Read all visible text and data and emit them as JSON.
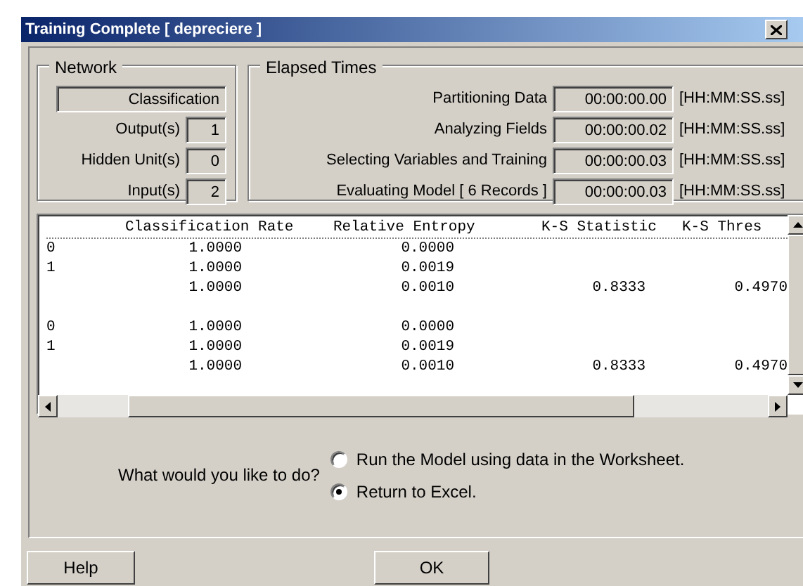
{
  "window": {
    "title": "Training Complete [ depreciere ]"
  },
  "network": {
    "group_label": "Network",
    "type_value": "Classification",
    "fields": [
      {
        "label": "Output(s)",
        "value": "1"
      },
      {
        "label": "Hidden Unit(s)",
        "value": "0"
      },
      {
        "label": "Input(s)",
        "value": "2"
      }
    ]
  },
  "elapsed": {
    "group_label": "Elapsed Times",
    "rows": [
      {
        "label": "Partitioning Data",
        "value": "00:00:00.00",
        "unit": "[HH:MM:SS.ss]"
      },
      {
        "label": "Analyzing Fields",
        "value": "00:00:00.02",
        "unit": "[HH:MM:SS.ss]"
      },
      {
        "label": "Selecting Variables and Training",
        "value": "00:00:00.03",
        "unit": "[HH:MM:SS.ss]"
      },
      {
        "label": "Evaluating Model [ 6 Records ]",
        "value": "00:00:00.03",
        "unit": "[HH:MM:SS.ss]"
      }
    ]
  },
  "results": {
    "columns": [
      "Classification Rate",
      "Relative Entropy",
      "K-S Statistic",
      "K-S Thres"
    ],
    "groups": [
      {
        "rows": [
          {
            "label": "0",
            "classification_rate": "1.0000",
            "relative_entropy": "0.0000"
          },
          {
            "label": "1",
            "classification_rate": "1.0000",
            "relative_entropy": "0.0019"
          },
          {
            "classification_rate": "1.0000",
            "relative_entropy": "0.0010",
            "ks_statistic": "0.8333",
            "ks_threshold": "0.4970"
          }
        ]
      },
      {
        "rows": [
          {
            "label": "0",
            "classification_rate": "1.0000",
            "relative_entropy": "0.0000"
          },
          {
            "label": "1",
            "classification_rate": "1.0000",
            "relative_entropy": "0.0019"
          },
          {
            "classification_rate": "1.0000",
            "relative_entropy": "0.0010",
            "ks_statistic": "0.8333",
            "ks_threshold": "0.4970"
          }
        ]
      }
    ]
  },
  "question": {
    "prompt": "What would you like to do?",
    "options": [
      {
        "label": "Run the Model using data in the Worksheet.",
        "selected": false
      },
      {
        "label": "Return to Excel.",
        "selected": true
      }
    ]
  },
  "buttons": [
    "Help",
    "OK"
  ]
}
